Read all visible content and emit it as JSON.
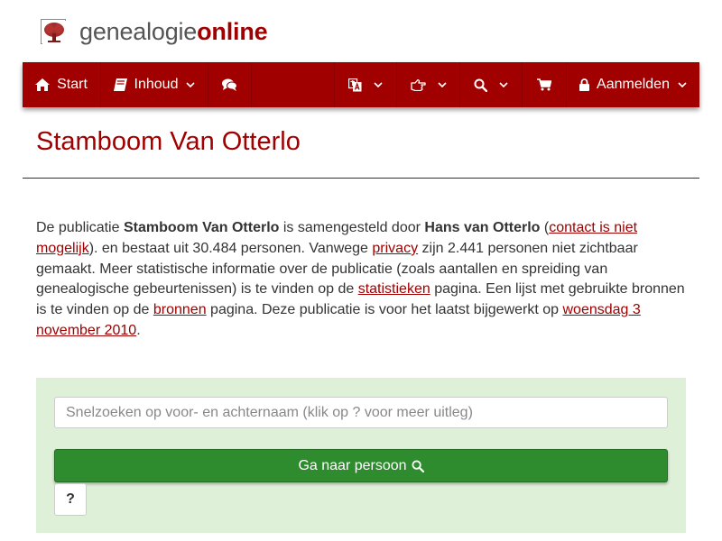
{
  "brand": {
    "part1": "genealogie",
    "part2": "online"
  },
  "nav": {
    "start": "Start",
    "inhoud": "Inhoud",
    "aanmelden": "Aanmelden",
    "icons": [
      "home-icon",
      "book-icon",
      "comments-icon",
      "language-icon",
      "hand-point-icon",
      "search-icon",
      "cart-icon",
      "lock-icon",
      "chevron-down-icon"
    ]
  },
  "page": {
    "title": "Stamboom Van Otterlo"
  },
  "intro": {
    "t1": "De publicatie ",
    "pub_name": "Stamboom Van Otterlo",
    "t2": " is samengesteld door ",
    "author": "Hans van Otterlo",
    "t3": " (",
    "contact_link": "contact is niet mogelijk",
    "t4": "). en bestaat uit 30.484 personen. Vanwege ",
    "privacy_link": "privacy",
    "t5": " zijn 2.441 personen niet zichtbaar gemaakt. Meer statistische informatie over de publicatie (zoals aantallen en spreiding van genealogische gebeurtenissen) is te vinden op de ",
    "stats_link": "statistieken",
    "t6": " pagina. Een lijst met gebruikte bronnen is te vinden op de ",
    "sources_link": "bronnen",
    "t7": " pagina. Deze publicatie is voor het laatst bijgewerkt op ",
    "date_link": "woensdag 3 november 2010",
    "t8": "."
  },
  "search": {
    "placeholder": "Snelzoeken op voor- en achternaam (klik op ? voor meer uitleg)",
    "button_label": "Ga naar persoon",
    "help_label": "?"
  },
  "colors": {
    "brand_red": "#a00000",
    "search_bg": "#dff0d8",
    "button_green": "#2e8b2e"
  }
}
